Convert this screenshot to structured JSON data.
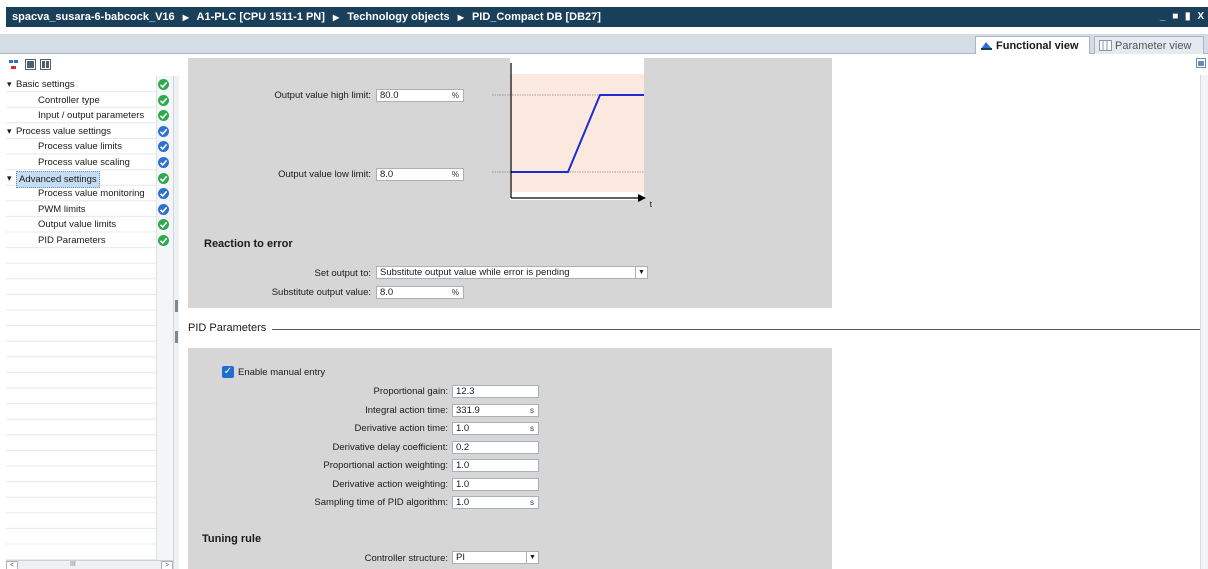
{
  "window": {
    "breadcrumb": [
      "spacva_susara-6-babcock_V16",
      "A1-PLC [CPU 1511-1 PN]",
      "Technology objects",
      "PID_Compact DB [DB27]"
    ],
    "controls": "_ ■ ▮ X"
  },
  "view_tabs": {
    "functional": "Functional view",
    "parameter": "Parameter view"
  },
  "tree": {
    "items": [
      {
        "label": "Basic settings",
        "level": 0,
        "expanded": true,
        "status": "ok"
      },
      {
        "label": "Controller type",
        "level": 1,
        "status": "ok"
      },
      {
        "label": "Input / output parameters",
        "level": 1,
        "status": "ok"
      },
      {
        "label": "Process value settings",
        "level": 0,
        "expanded": true,
        "status": "info"
      },
      {
        "label": "Process value limits",
        "level": 1,
        "status": "info"
      },
      {
        "label": "Process value scaling",
        "level": 1,
        "status": "info"
      },
      {
        "label": "Advanced settings",
        "level": 0,
        "expanded": true,
        "status": "ok",
        "selected": true
      },
      {
        "label": "Process value monitoring",
        "level": 1,
        "status": "info"
      },
      {
        "label": "PWM limits",
        "level": 1,
        "status": "info"
      },
      {
        "label": "Output value limits",
        "level": 1,
        "status": "ok"
      },
      {
        "label": "PID Parameters",
        "level": 1,
        "status": "ok"
      }
    ]
  },
  "output_limits": {
    "high_label": "Output value high limit:",
    "high_value": "80.0",
    "low_label": "Output value low limit:",
    "low_value": "8.0",
    "unit": "%",
    "chart_axis": "t"
  },
  "reaction_to_error": {
    "title": "Reaction to error",
    "set_output_label": "Set output to:",
    "set_output_value": "Substitute output value while error is pending",
    "substitute_label": "Substitute output value:",
    "substitute_value": "8.0",
    "unit": "%"
  },
  "pid_parameters": {
    "section": "PID Parameters",
    "enable_manual_label": "Enable manual entry",
    "enable_manual_checked": true,
    "fields": [
      {
        "label": "Proportional gain:",
        "value": "12.3",
        "unit": ""
      },
      {
        "label": "Integral action time:",
        "value": "331.9",
        "unit": "s"
      },
      {
        "label": "Derivative action time:",
        "value": "1.0",
        "unit": "s"
      },
      {
        "label": "Derivative delay coefficient:",
        "value": "0.2",
        "unit": ""
      },
      {
        "label": "Proportional action weighting:",
        "value": "1.0",
        "unit": ""
      },
      {
        "label": "Derivative action weighting:",
        "value": "1.0",
        "unit": ""
      },
      {
        "label": "Sampling time of PID algorithm:",
        "value": "1.0",
        "unit": "s"
      }
    ],
    "tuning_title": "Tuning rule",
    "controller_structure_label": "Controller structure:",
    "controller_structure_value": "PI"
  },
  "scroll": {
    "left_btn": "<",
    "right_btn": ">",
    "thumb": "III"
  },
  "colors": {
    "titlebar": "#1a3f5a",
    "panel": "#d6d6d6",
    "check_ok": "#2fa84f",
    "check_info": "#2f6fd0",
    "chart_line": "#1f2bd6",
    "chart_bg": "#fbe9e0"
  }
}
